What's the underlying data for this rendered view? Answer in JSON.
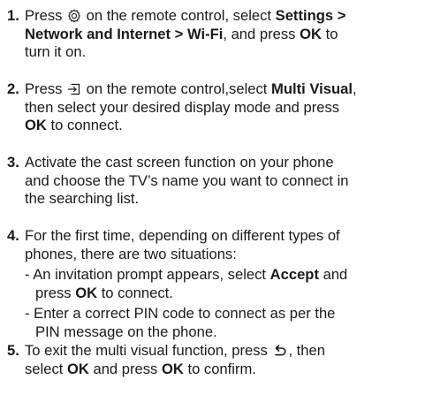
{
  "steps": [
    {
      "number": "1.",
      "text_a": "Press ",
      "icon": "gear-icon",
      "text_b": " on the remote control, select ",
      "bold_a": "Settings >",
      "bold_b": "Network and Internet > Wi-Fi",
      "text_c": ", and press ",
      "bold_c": "OK",
      "text_d": " to",
      "text_e": "turn it on."
    },
    {
      "number": "2.",
      "text_a": "Press ",
      "icon": "input-source-icon",
      "text_b": " on the remote control,select ",
      "bold_a": "Multi Visual",
      "text_c": ",",
      "text_d": "then select your desired display mode and press",
      "bold_b": "OK",
      "text_e": " to connect."
    },
    {
      "number": "3.",
      "line_1": "Activate the cast screen function on your phone",
      "line_2": "and choose the TV’s name you want to connect in",
      "line_3": "the searching list."
    },
    {
      "number": "4.",
      "line_1": "For the first time, depending on different types of",
      "line_2": "phones, there are two situations:",
      "sub_1": {
        "text_a": "- An invitation prompt appears, select ",
        "bold_a": "Accept",
        "text_b": " and",
        "text_c": "press ",
        "bold_b": "OK",
        "text_d": " to connect."
      },
      "sub_2": {
        "line_1": "- Enter a correct PIN code to connect as per the",
        "line_2": "PIN message on the phone."
      }
    },
    {
      "number": "5.",
      "text_a": "To exit the multi visual function, press ",
      "icon": "back-icon",
      "text_b": ", then",
      "text_c": "select ",
      "bold_a": "OK",
      "text_d": " and press ",
      "bold_b": "OK",
      "text_e": " to confirm."
    }
  ]
}
